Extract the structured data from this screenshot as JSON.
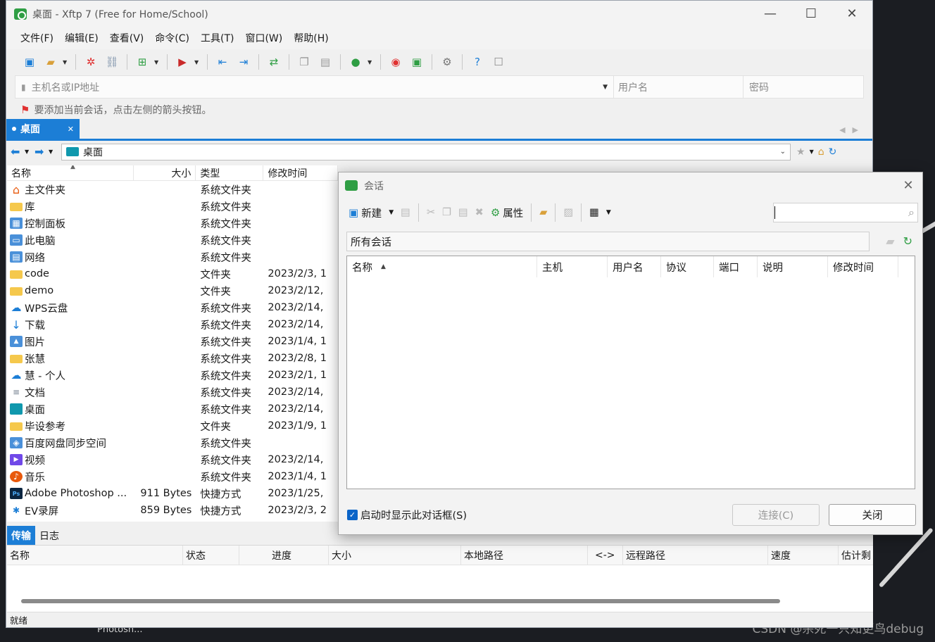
{
  "window": {
    "title": "桌面 - Xftp 7 (Free for Home/School)",
    "minimize": "—",
    "maximize": "☐",
    "close": "✕"
  },
  "menu": [
    "文件(F)",
    "编辑(E)",
    "查看(V)",
    "命令(C)",
    "工具(T)",
    "窗口(W)",
    "帮助(H)"
  ],
  "address": {
    "host_placeholder": "主机名或IP地址",
    "user_placeholder": "用户名",
    "password_placeholder": "密码"
  },
  "hint": "要添加当前会话，点击左侧的箭头按钮。",
  "tab": {
    "label": "桌面"
  },
  "path": "桌面",
  "filelist": {
    "headers": [
      "名称",
      "大小",
      "类型",
      "修改时间"
    ],
    "rows": [
      {
        "icon": "home-icon",
        "name": "主文件夹",
        "size": "",
        "type": "系统文件夹",
        "modified": ""
      },
      {
        "icon": "folder-icon",
        "name": "库",
        "size": "",
        "type": "系统文件夹",
        "modified": ""
      },
      {
        "icon": "control-panel-icon",
        "name": "控制面板",
        "size": "",
        "type": "系统文件夹",
        "modified": ""
      },
      {
        "icon": "computer-icon",
        "name": "此电脑",
        "size": "",
        "type": "系统文件夹",
        "modified": ""
      },
      {
        "icon": "network-icon",
        "name": "网络",
        "size": "",
        "type": "系统文件夹",
        "modified": ""
      },
      {
        "icon": "folder-icon",
        "name": "code",
        "size": "",
        "type": "文件夹",
        "modified": "2023/2/3, 1"
      },
      {
        "icon": "folder-icon",
        "name": "demo",
        "size": "",
        "type": "文件夹",
        "modified": "2023/2/12,"
      },
      {
        "icon": "cloud-icon",
        "name": "WPS云盘",
        "size": "",
        "type": "系统文件夹",
        "modified": "2023/2/14,"
      },
      {
        "icon": "download-icon",
        "name": "下载",
        "size": "",
        "type": "系统文件夹",
        "modified": "2023/2/14,"
      },
      {
        "icon": "pictures-icon",
        "name": "图片",
        "size": "",
        "type": "系统文件夹",
        "modified": "2023/1/4, 1"
      },
      {
        "icon": "folder-icon",
        "name": "张慧",
        "size": "",
        "type": "系统文件夹",
        "modified": "2023/2/8, 1"
      },
      {
        "icon": "onedrive-icon",
        "name": "慧 - 个人",
        "size": "",
        "type": "系统文件夹",
        "modified": "2023/2/1, 1"
      },
      {
        "icon": "document-icon",
        "name": "文档",
        "size": "",
        "type": "系统文件夹",
        "modified": "2023/2/14,"
      },
      {
        "icon": "desktop-icon",
        "name": "桌面",
        "size": "",
        "type": "系统文件夹",
        "modified": "2023/2/14,"
      },
      {
        "icon": "folder-icon",
        "name": "毕设参考",
        "size": "",
        "type": "文件夹",
        "modified": "2023/1/9, 1"
      },
      {
        "icon": "baidu-sync-icon",
        "name": "百度网盘同步空间",
        "size": "",
        "type": "系统文件夹",
        "modified": ""
      },
      {
        "icon": "video-icon",
        "name": "视频",
        "size": "",
        "type": "系统文件夹",
        "modified": "2023/2/14,"
      },
      {
        "icon": "music-icon",
        "name": "音乐",
        "size": "",
        "type": "系统文件夹",
        "modified": "2023/1/4, 1"
      },
      {
        "icon": "photoshop-icon",
        "name": "Adobe Photoshop ...",
        "size": "911 Bytes",
        "type": "快捷方式",
        "modified": "2023/1/25,"
      },
      {
        "icon": "ev-recorder-icon",
        "name": "EV录屏",
        "size": "859 Bytes",
        "type": "快捷方式",
        "modified": "2023/2/3, 2"
      }
    ]
  },
  "transfer": {
    "tabs": [
      "传输",
      "日志"
    ],
    "headers": [
      "名称",
      "状态",
      "进度",
      "大小",
      "本地路径",
      "<->",
      "远程路径",
      "速度",
      "估计剩"
    ]
  },
  "status": "就绪",
  "dialog": {
    "title": "会话",
    "new_label": "新建",
    "properties_label": "属性",
    "folder_label": "所有会话",
    "headers": [
      "名称",
      "主机",
      "用户名",
      "协议",
      "端口",
      "说明",
      "修改时间"
    ],
    "checkbox_label": "启动时显示此对话框(S)",
    "connect_label": "连接(C)",
    "close_label": "关闭"
  },
  "desktop": {
    "watermark": "CSDN @杀死一只知更鸟debug",
    "taskbar_label": "Photosh..."
  },
  "colors": {
    "accent": "#1c7ed6",
    "app_green": "#2f9e44"
  }
}
